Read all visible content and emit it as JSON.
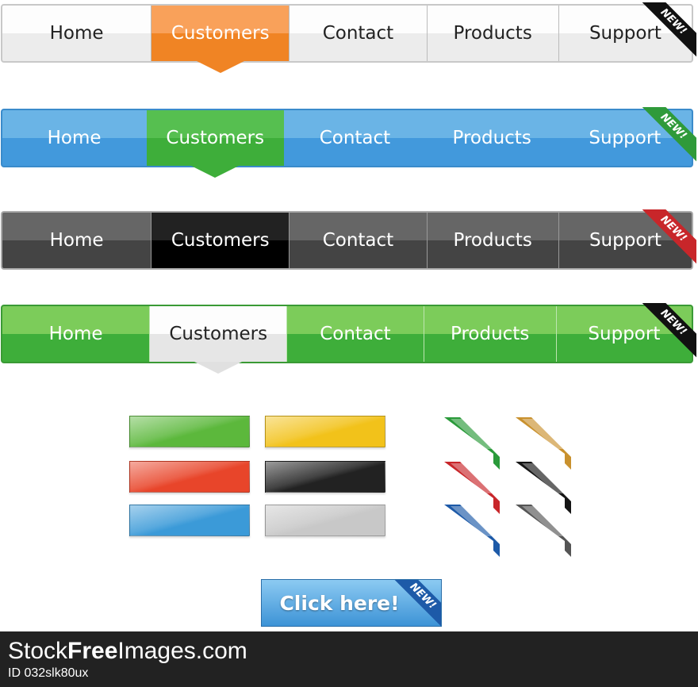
{
  "navbars": [
    {
      "theme": "white",
      "items": [
        "Home",
        "Customers",
        "Contact",
        "Products",
        "Support"
      ],
      "active": 1,
      "badge": "NEW!",
      "badge_color": "#111111"
    },
    {
      "theme": "blue",
      "items": [
        "Home",
        "Customers",
        "Contact",
        "Products",
        "Support"
      ],
      "active": 1,
      "badge": "NEW!",
      "badge_color": "#2f9a3a"
    },
    {
      "theme": "dark",
      "items": [
        "Home",
        "Customers",
        "Contact",
        "Products",
        "Support"
      ],
      "active": 1,
      "badge": "NEW!",
      "badge_color": "#c8262a"
    },
    {
      "theme": "green",
      "items": [
        "Home",
        "Customers",
        "Contact",
        "Products",
        "Support"
      ],
      "active": 1,
      "badge": "NEW!",
      "badge_color": "#111111"
    }
  ],
  "swatches": [
    "#5cb83c",
    "#f2c21a",
    "#e8452a",
    "#222222",
    "#3b9ad8",
    "#c8c8c8"
  ],
  "corner_ribbons": [
    "#2a9a3a",
    "#c9912e",
    "#c8262a",
    "#151515",
    "#1d5aa8",
    "#555555"
  ],
  "cta": {
    "label": "Click here!",
    "badge": "NEW!",
    "badge_color": "#1d5aa8"
  },
  "footer": {
    "brand_a": "Stock",
    "brand_b": "Free",
    "brand_c": "Images.com",
    "id": "ID 032slk80ux"
  }
}
